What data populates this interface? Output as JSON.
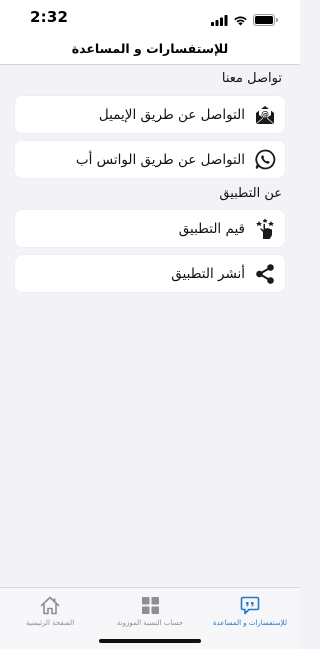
{
  "status": {
    "time": "2:32"
  },
  "header": {
    "title": "للإستفسارات و المساعدة"
  },
  "sections": [
    {
      "title": "تواصل معنا",
      "items": [
        {
          "label": "التواصل عن طريق الإيميل",
          "icon": "email-icon"
        },
        {
          "label": "التواصل عن طريق الواتس أب",
          "icon": "whatsapp-icon"
        }
      ]
    },
    {
      "title": "عن التطبيق",
      "items": [
        {
          "label": "قيم التطبيق",
          "icon": "rate-hand-icon"
        },
        {
          "label": "أنشر التطبيق",
          "icon": "share-icon"
        }
      ]
    }
  ],
  "tabbar": {
    "active_color": "#2479c9",
    "tabs": [
      {
        "label": "للإستفسارات و المساعدة",
        "icon": "chat-bubble-icon",
        "active": true
      },
      {
        "label": "حساب النسبة الموزونة",
        "icon": "grid-icon",
        "active": false
      },
      {
        "label": "الصفحة الرئيسية",
        "icon": "home-icon",
        "active": false
      }
    ]
  }
}
